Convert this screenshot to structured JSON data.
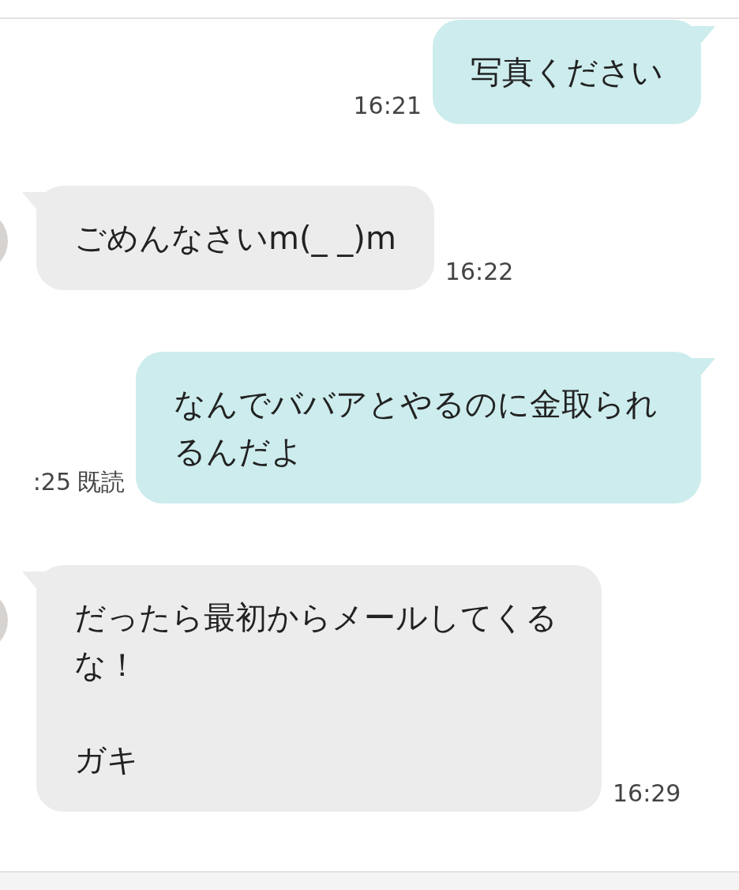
{
  "messages": [
    {
      "kind": "sent",
      "paragraphs": [
        "写真ください"
      ],
      "time": "16:21"
    },
    {
      "kind": "received",
      "paragraphs": [
        "ごめんなさいm(_ _)m"
      ],
      "time": "16:22"
    },
    {
      "kind": "sent",
      "paragraphs": [
        "なんでババアとやるのに金取られるんだよ"
      ],
      "time": ":25",
      "read_label": "既読"
    },
    {
      "kind": "received",
      "paragraphs": [
        "だったら最初からメールしてくるな！",
        "ガキ"
      ],
      "time": "16:29"
    }
  ]
}
